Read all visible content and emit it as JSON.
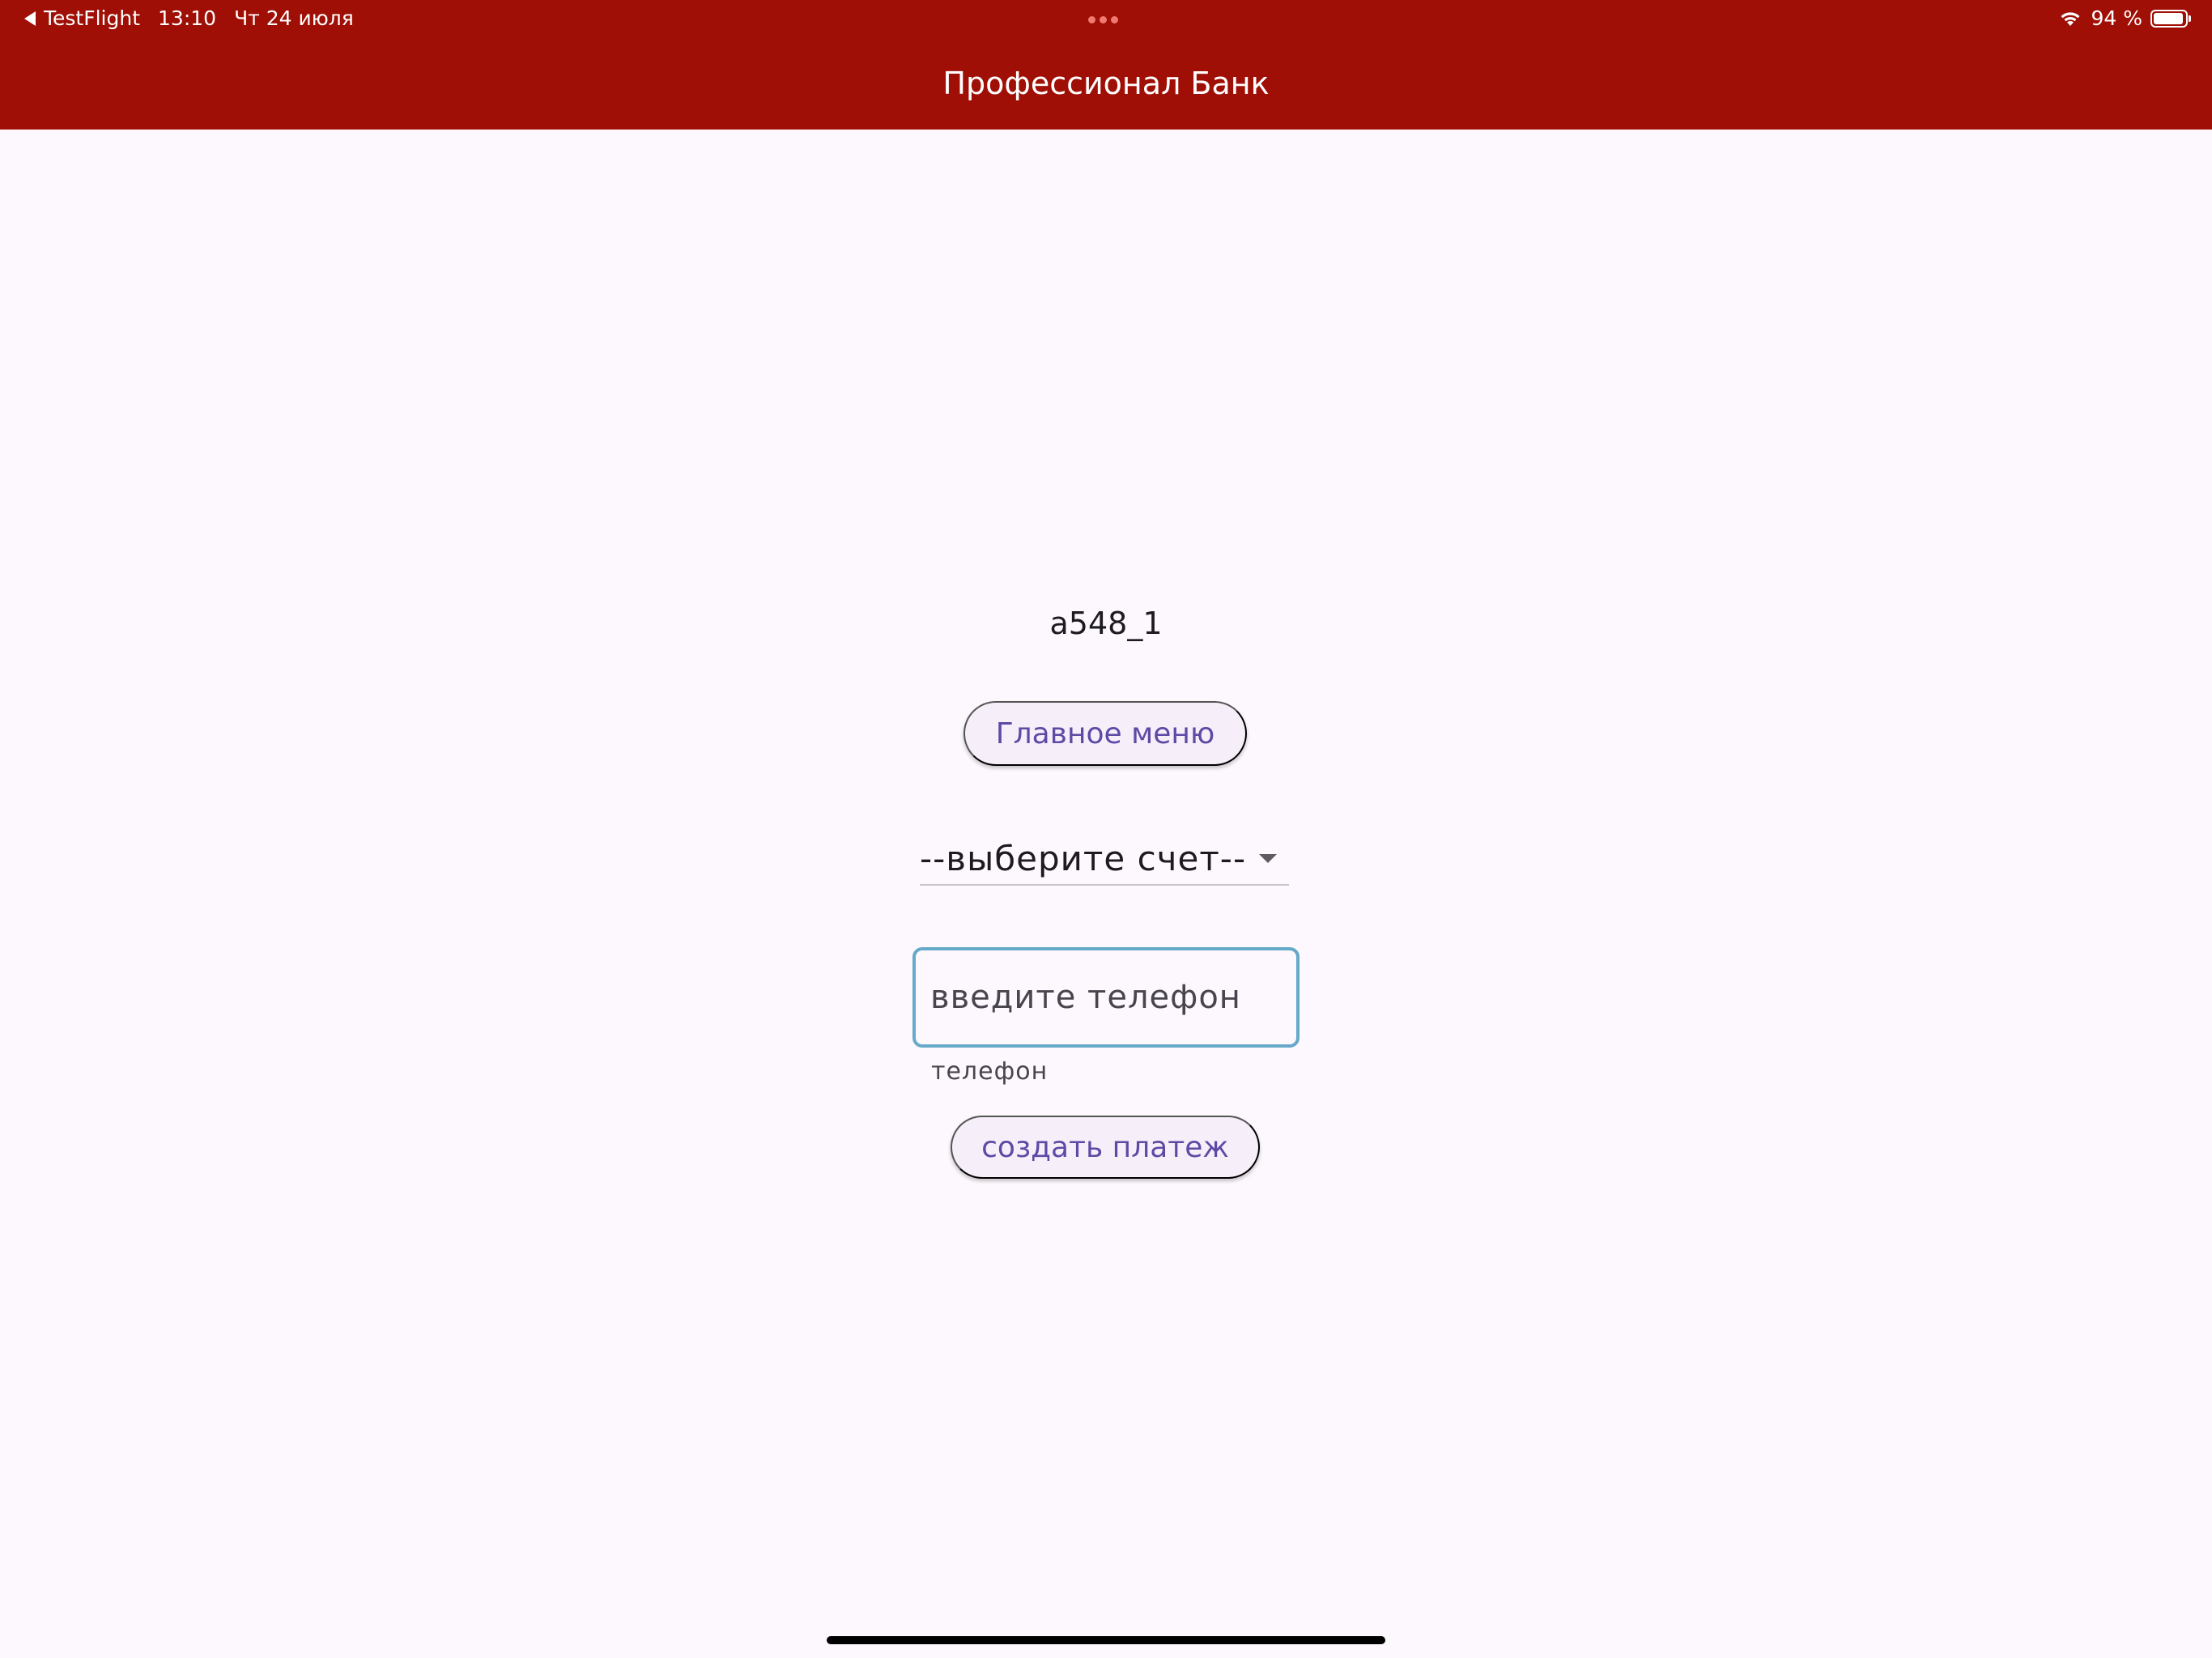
{
  "status_bar": {
    "back_app": "TestFlight",
    "time": "13:10",
    "date": "Чт 24 июля",
    "battery_percent": "94 %",
    "battery_level": 0.94,
    "icons": [
      "back-arrow-icon",
      "multitasking-dots-icon",
      "wifi-icon",
      "battery-icon"
    ]
  },
  "app_bar": {
    "title": "Профессионал Банк",
    "background_color": "#9f0f05"
  },
  "main": {
    "account_label": "a548_1",
    "main_menu_button": "Главное меню",
    "account_dropdown": {
      "selected": "--выберите счет--"
    },
    "phone_input": {
      "value": "",
      "placeholder": "введите телефон",
      "helper": "телефон",
      "border_color": "#66a9c9"
    },
    "create_payment_button": "создать платеж",
    "button_text_color": "#5d4aa5"
  }
}
